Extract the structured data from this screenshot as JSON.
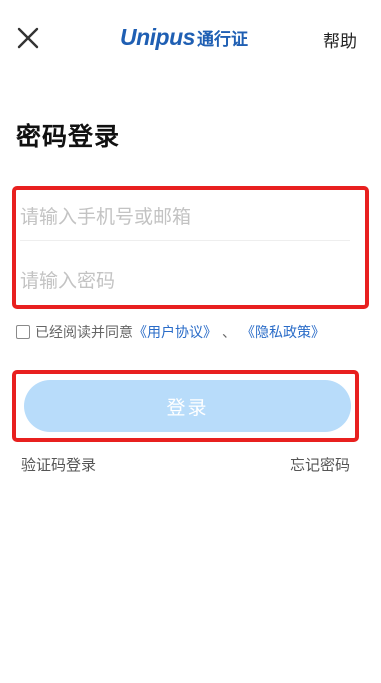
{
  "header": {
    "brand_logo": "Unipus",
    "brand_tag": "通行证",
    "help": "帮助"
  },
  "title": "密码登录",
  "form": {
    "phone_placeholder": "请输入手机号或邮箱",
    "password_placeholder": "请输入密码"
  },
  "agreement": {
    "text": "已经阅读并同意",
    "user_agreement": "《用户协议》",
    "separator": "、",
    "privacy_policy": "《隐私政策》"
  },
  "login_button": "登录",
  "links": {
    "sms_login": "验证码登录",
    "forgot_password": "忘记密码"
  },
  "colors": {
    "brand": "#1f5fb3",
    "link": "#2a6cc8",
    "button_disabled": "#b8dcfa",
    "highlight": "#e8201f"
  }
}
